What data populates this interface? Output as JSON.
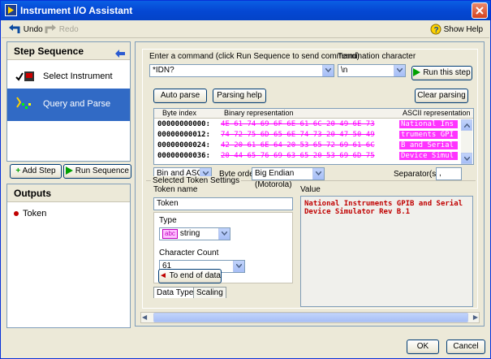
{
  "window": {
    "title": "Instrument I/O Assistant"
  },
  "toolbar": {
    "undo": "Undo",
    "redo": "Redo",
    "help": "Show Help"
  },
  "step_sequence": {
    "title": "Step Sequence",
    "steps": [
      {
        "label": "Select Instrument",
        "icon": "instrument-icon"
      },
      {
        "label": "Query and Parse",
        "icon": "query-parse-icon",
        "selected": true
      }
    ],
    "add_step": "Add Step",
    "run_sequence": "Run Sequence"
  },
  "outputs": {
    "title": "Outputs",
    "items": [
      "Token"
    ]
  },
  "command": {
    "label": "Enter a command (click Run Sequence to send command)",
    "value": "*IDN?",
    "termination_label": "Termination character",
    "termination_value": "\\n",
    "run_this_step": "Run this step"
  },
  "parse_buttons": {
    "auto_parse": "Auto parse",
    "parsing_help": "Parsing help",
    "clear_parsing": "Clear parsing"
  },
  "byte_table": {
    "headers": {
      "index": "Byte index",
      "binary": "Binary representation",
      "ascii": "ASCII representation"
    },
    "rows": [
      {
        "index": "00000000000:",
        "hex": "4E 61 74 69 6F 6E 61 6C 20 49 6E 73",
        "ascii": "National Ins"
      },
      {
        "index": "00000000012:",
        "hex": "74 72 75 6D 65 6E 74 73 20 47 50 49",
        "ascii": "truments GPI"
      },
      {
        "index": "00000000024:",
        "hex": "42 20 61 6E 64 20 53 65 72 69 61 6C",
        "ascii": "B and Serial"
      },
      {
        "index": "00000000036:",
        "hex": "20 44 65 76 69 63 65 20 53 69 6D 75",
        "ascii": "Device Simul"
      }
    ]
  },
  "display": {
    "mode_value": "Bin and ASCII",
    "byte_order_label": "Byte order",
    "byte_order_value": "Big Endian (Motorola)",
    "separator_label": "Separator(s)",
    "separator_value": ","
  },
  "token_settings": {
    "group_label": "Selected Token Settings",
    "name_label": "Token name",
    "name_value": "Token",
    "type_label": "Type",
    "type_badge": "abc",
    "type_value": "string",
    "char_count_label": "Character Count",
    "char_count_value": "61",
    "to_end_button": "To end of data",
    "tab_data_type": "Data Type",
    "tab_scaling": "Scaling",
    "value_label": "Value",
    "value_text": "National Instruments GPIB and Serial Device Simulator Rev B.1"
  },
  "footer": {
    "ok": "OK",
    "cancel": "Cancel"
  },
  "colors": {
    "title_blue": "#0548d4",
    "selected_step": "#316ac5",
    "ascii_highlight": "#ff33ff",
    "value_text": "#c00000"
  }
}
